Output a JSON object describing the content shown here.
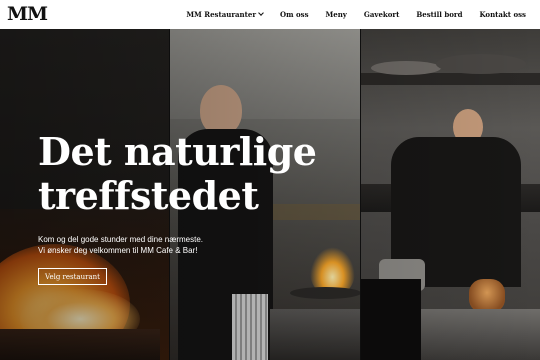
{
  "logo": {
    "text": "MM"
  },
  "nav": {
    "items": [
      {
        "label": "MM Restauranter",
        "has_dropdown": true
      },
      {
        "label": "Om oss"
      },
      {
        "label": "Meny"
      },
      {
        "label": "Gavekort"
      },
      {
        "label": "Bestill bord"
      },
      {
        "label": "Kontakt oss"
      }
    ]
  },
  "hero": {
    "headline_line1": "Det naturlige",
    "headline_line2": "treffstedet",
    "subtext_line1": "Kom og del gode stunder med dine nærmeste.",
    "subtext_line2": "Vi ønsker deg velkommen til MM Cafe & Bar!",
    "cta_label": "Velg restaurant"
  },
  "colors": {
    "header_bg": "#ffffff",
    "text_dark": "#111111",
    "hero_text": "#ffffff",
    "flame": "#f28a1e"
  }
}
